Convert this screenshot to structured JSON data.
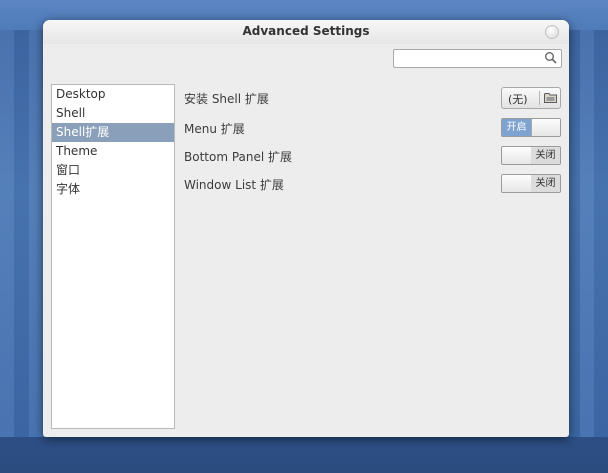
{
  "window": {
    "title": "Advanced Settings"
  },
  "search": {
    "value": "",
    "placeholder": ""
  },
  "sidebar": {
    "items": [
      {
        "label": "Desktop",
        "selected": false
      },
      {
        "label": "Shell",
        "selected": false
      },
      {
        "label": "Shell扩展",
        "selected": true
      },
      {
        "label": "Theme",
        "selected": false
      },
      {
        "label": "窗口",
        "selected": false
      },
      {
        "label": "字体",
        "selected": false
      }
    ]
  },
  "settings": {
    "install_shell_extension": {
      "label": "安装 Shell 扩展",
      "button_label": "(无)",
      "icon": "folder-icon"
    },
    "menu_extension": {
      "label": "Menu 扩展",
      "toggle_text": "开启",
      "state": "on"
    },
    "bottom_panel_extension": {
      "label": "Bottom Panel 扩展",
      "toggle_text": "关闭",
      "state": "off"
    },
    "window_list_extension": {
      "label": "Window List 扩展",
      "toggle_text": "关闭",
      "state": "off"
    }
  },
  "colors": {
    "selection": "#8a9fba",
    "toggle_on": "#7ea3d1",
    "desktop": "#4a78b6"
  }
}
